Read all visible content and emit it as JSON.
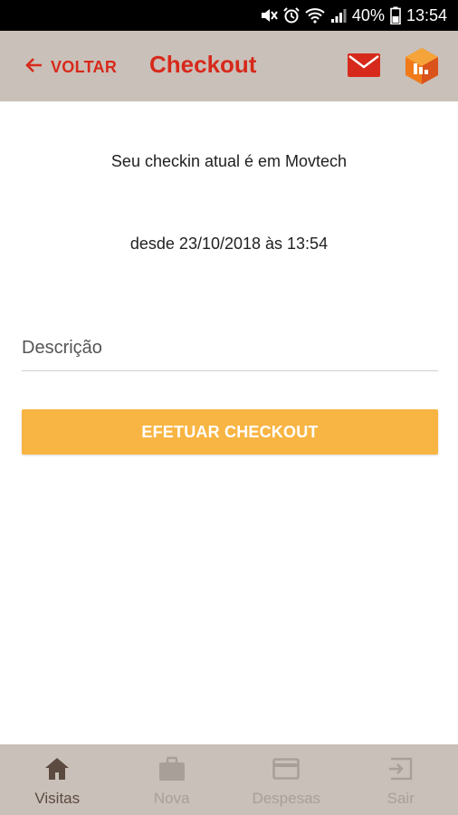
{
  "status_bar": {
    "battery": "40%",
    "time": "13:54",
    "icons": [
      "mute-icon",
      "alarm-icon",
      "wifi-icon",
      "signal-icon",
      "battery-icon"
    ]
  },
  "app_bar": {
    "back_label": "VOLTAR",
    "title": "Checkout",
    "icons": [
      "mail-icon",
      "app-logo-icon"
    ]
  },
  "main": {
    "checkin_text": "Seu checkin atual é em Movtech",
    "since_text": "desde 23/10/2018 às 13:54",
    "description_placeholder": "Descrição",
    "description_value": "",
    "checkout_button": "EFETUAR CHECKOUT"
  },
  "bottom_nav": {
    "items": [
      {
        "label": "Visitas",
        "icon": "home-icon",
        "active": true
      },
      {
        "label": "Nova",
        "icon": "briefcase-icon",
        "active": false
      },
      {
        "label": "Despesas",
        "icon": "credit-card-icon",
        "active": false
      },
      {
        "label": "Sair",
        "icon": "exit-icon",
        "active": false
      }
    ]
  },
  "colors": {
    "accent_red": "#d7291b",
    "bar_bg": "#c9c0b9",
    "button_orange": "#f8b543",
    "nav_active": "#5b4a40",
    "nav_inactive": "#a89f99"
  }
}
